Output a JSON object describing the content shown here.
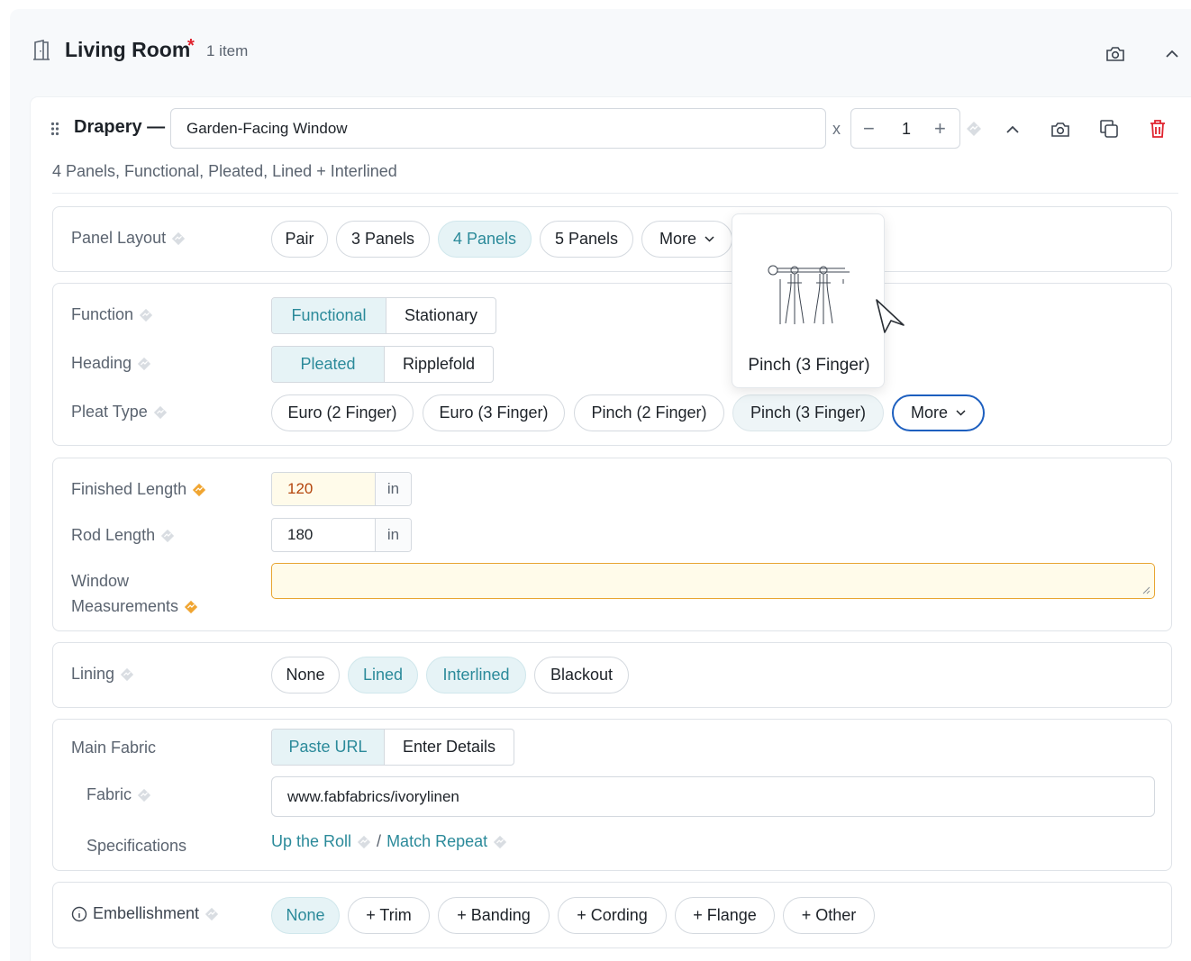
{
  "room": {
    "title": "Living Room",
    "required_mark": "*",
    "item_count": "1 item"
  },
  "item": {
    "type_label": "Drapery —",
    "name_value": "Garden-Facing Window",
    "times": "x",
    "quantity": "1",
    "minus": "−",
    "plus": "+",
    "summary": "4 Panels, Functional, Pleated, Lined + Interlined"
  },
  "panel_layout": {
    "label": "Panel Layout",
    "options": [
      "Pair",
      "3 Panels",
      "4 Panels",
      "5 Panels",
      "More"
    ],
    "selected": "4 Panels"
  },
  "function": {
    "label": "Function",
    "options": [
      "Functional",
      "Stationary"
    ],
    "selected": "Functional"
  },
  "heading": {
    "label": "Heading",
    "options": [
      "Pleated",
      "Ripplefold"
    ],
    "selected": "Pleated"
  },
  "pleat_type": {
    "label": "Pleat Type",
    "options": [
      "Euro (2 Finger)",
      "Euro (3 Finger)",
      "Pinch (2 Finger)",
      "Pinch (3 Finger)",
      "More"
    ],
    "hovered": "Pinch (3 Finger)"
  },
  "tooltip": {
    "label": "Pinch (3 Finger)",
    "image_icon": "pinch-pleat-illustration"
  },
  "measurements": {
    "finished_length": {
      "label": "Finished Length",
      "value": "120",
      "unit": "in"
    },
    "rod_length": {
      "label": "Rod Length",
      "value": "180",
      "unit": "in"
    },
    "window_measurements": {
      "label_line1": "Window",
      "label_line2": "Measurements",
      "value": ""
    }
  },
  "lining": {
    "label": "Lining",
    "options": [
      "None",
      "Lined",
      "Interlined",
      "Blackout"
    ],
    "selected": [
      "Lined",
      "Interlined"
    ]
  },
  "main_fabric": {
    "label": "Main Fabric",
    "modes": [
      "Paste URL",
      "Enter Details"
    ],
    "selected_mode": "Paste URL",
    "fabric_label": "Fabric",
    "fabric_url": "www.fabfabrics/ivorylinen",
    "specs_label": "Specifications",
    "spec_link_1": "Up the Roll",
    "spec_sep": "/",
    "spec_link_2": "Match Repeat"
  },
  "embellishment": {
    "label": "Embellishment",
    "options": [
      "None",
      "+ Trim",
      "+ Banding",
      "+ Cording",
      "+ Flange",
      "+ Other"
    ],
    "selected": "None"
  },
  "colors": {
    "accent": "#2b8a9a",
    "selected_bg": "#e6f3f6",
    "warning": "#e8a532",
    "danger": "#e0232e",
    "focus": "#1d5fbf"
  }
}
